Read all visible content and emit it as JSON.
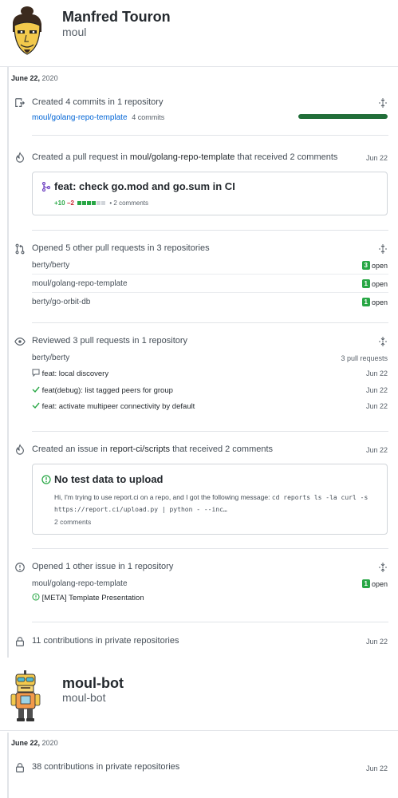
{
  "profiles": [
    {
      "name": "Manfred Touron",
      "login": "moul",
      "date": "June 22,",
      "year": "2020",
      "activities": {
        "commits": {
          "title": "Created 4 commits in 1 repository",
          "repo": "moul/golang-repo-template",
          "count": "4 commits",
          "progress": 1.0
        },
        "pull_request": {
          "title_prefix": "Created a pull request in",
          "repo": "moul/golang-repo-template",
          "title_suffix": "that received 2 comments",
          "date": "Jun 22",
          "card_title": "feat: check go.mod and go.sum in CI",
          "additions": "+10",
          "deletions": "−2",
          "comments": "• 2 comments",
          "diff_blocks": [
            "add",
            "add",
            "add",
            "add",
            "neutral",
            "neutral"
          ]
        },
        "other_prs": {
          "title": "Opened 5 other pull requests in 3 repositories",
          "rows": [
            {
              "repo": "berty/berty",
              "count": "3",
              "state": "open"
            },
            {
              "repo": "moul/golang-repo-template",
              "count": "1",
              "state": "open"
            },
            {
              "repo": "berty/go-orbit-db",
              "count": "1",
              "state": "open"
            }
          ]
        },
        "reviews": {
          "title": "Reviewed 3 pull requests in 1 repository",
          "repo": "berty/berty",
          "repo_count": "3 pull requests",
          "items": [
            {
              "icon": "comment-icon",
              "label": "feat: local discovery",
              "date": "Jun 22"
            },
            {
              "icon": "check-icon",
              "label": "feat(debug): list tagged peers for group",
              "date": "Jun 22"
            },
            {
              "icon": "check-icon",
              "label": "feat: activate multipeer connectivity by default",
              "date": "Jun 22"
            }
          ]
        },
        "issue": {
          "title_prefix": "Created an issue in",
          "repo": "report-ci/scripts",
          "title_suffix": "that received 2 comments",
          "date": "Jun 22",
          "card_title": "No test data to upload",
          "body_text": "Hi, I'm trying to use report.ci on a repo, and I got the following message:",
          "body_code": "cd reports ls -la curl -s https://report.ci/upload.py | python - --inc…",
          "comments": "2 comments"
        },
        "other_issues": {
          "title": "Opened 1 other issue in 1 repository",
          "repo": "moul/golang-repo-template",
          "count": "1",
          "state": "open",
          "issue_label": "[META] Template Presentation"
        },
        "private": {
          "title": "11 contributions in private repositories",
          "date": "Jun 22"
        }
      }
    },
    {
      "name": "moul-bot",
      "login": "moul-bot",
      "date": "June 22,",
      "year": "2020",
      "private": {
        "title": "38 contributions in private repositories",
        "date": "Jun 22"
      }
    }
  ],
  "colors": {
    "link": "#0366d6",
    "green": "#28a745",
    "red": "#cb2431",
    "purple": "#6f42c1",
    "progress": "#216e39"
  }
}
